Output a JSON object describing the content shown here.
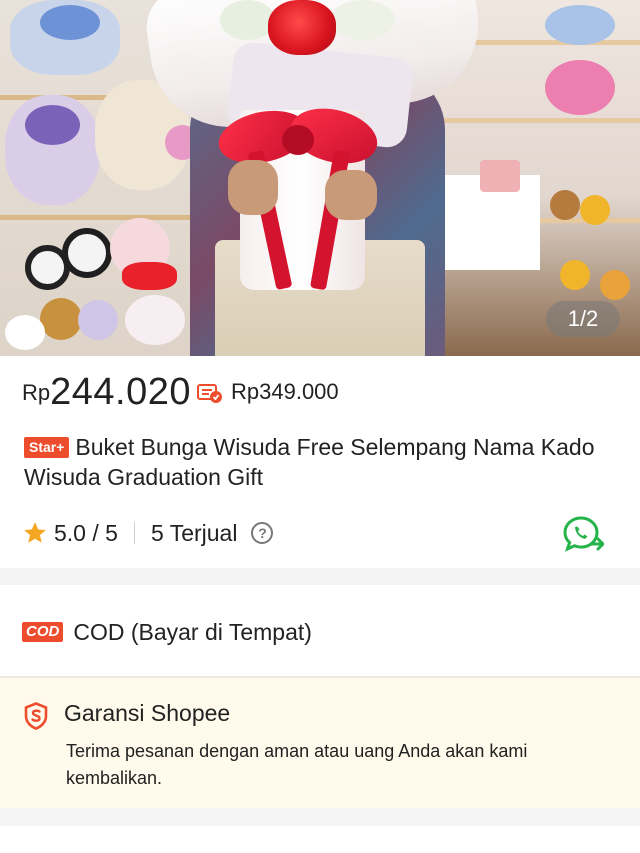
{
  "gallery": {
    "counter": "1/2"
  },
  "price": {
    "currency": "Rp",
    "current": "244.020",
    "original": "Rp349.000",
    "coin_icon": "coin-voucher-icon"
  },
  "product": {
    "badge": "Star+",
    "title": "Buket Bunga Wisuda Free Selempang Nama Kado Wisuda Graduation Gift"
  },
  "rating": {
    "score": "5.0 / 5",
    "sold": "5 Terjual",
    "help_symbol": "?"
  },
  "cod": {
    "badge": "COD",
    "label": "COD (Bayar di Tempat)"
  },
  "guarantee": {
    "title": "Garansi Shopee",
    "description": "Terima pesanan dengan aman atau uang Anda akan kami kembalikan."
  },
  "colors": {
    "brand": "#ee4d2d",
    "star": "#f5a623",
    "whatsapp": "#25b34b",
    "guarantee_bg": "#fffaeb"
  }
}
